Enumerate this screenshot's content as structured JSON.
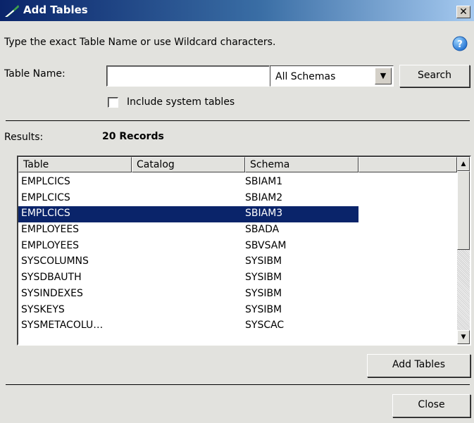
{
  "window": {
    "title": "Add Tables",
    "close_glyph": "✕"
  },
  "instruction": "Type the exact Table Name or use Wildcard characters.",
  "search": {
    "label": "Table Name:",
    "value": "",
    "schema_selected": "All Schemas",
    "search_label": "Search"
  },
  "include_system": {
    "label": "Include system tables",
    "checked": false
  },
  "results": {
    "label": "Results:",
    "count": "20 Records"
  },
  "table": {
    "columns": [
      "Table",
      "Catalog",
      "Schema",
      ""
    ],
    "rows": [
      {
        "table": "EMPLCICS",
        "catalog": "",
        "schema": "SBIAM1",
        "selected": false
      },
      {
        "table": "EMPLCICS",
        "catalog": "",
        "schema": "SBIAM2",
        "selected": false
      },
      {
        "table": "EMPLCICS",
        "catalog": "",
        "schema": "SBIAM3",
        "selected": true
      },
      {
        "table": "EMPLOYEES",
        "catalog": "",
        "schema": "SBADA",
        "selected": false
      },
      {
        "table": "EMPLOYEES",
        "catalog": "",
        "schema": "SBVSAM",
        "selected": false
      },
      {
        "table": "SYSCOLUMNS",
        "catalog": "",
        "schema": "SYSIBM",
        "selected": false
      },
      {
        "table": "SYSDBAUTH",
        "catalog": "",
        "schema": "SYSIBM",
        "selected": false
      },
      {
        "table": "SYSINDEXES",
        "catalog": "",
        "schema": "SYSIBM",
        "selected": false
      },
      {
        "table": "SYSKEYS",
        "catalog": "",
        "schema": "SYSIBM",
        "selected": false
      },
      {
        "table": "SYSMETACOLU…",
        "catalog": "",
        "schema": "SYSCAC",
        "selected": false
      }
    ]
  },
  "buttons": {
    "add_tables": "Add Tables",
    "close": "Close"
  },
  "icons": {
    "title": "datasource-icon",
    "help": "help-icon",
    "dropdown": "chevron-down-icon",
    "scroll_up": "scroll-up-icon",
    "scroll_down": "scroll-down-icon"
  },
  "colors": {
    "titlebar_start": "#0a246a",
    "titlebar_end": "#a6caf0",
    "selection": "#0a246a",
    "window_bg": "#e2e2de"
  }
}
